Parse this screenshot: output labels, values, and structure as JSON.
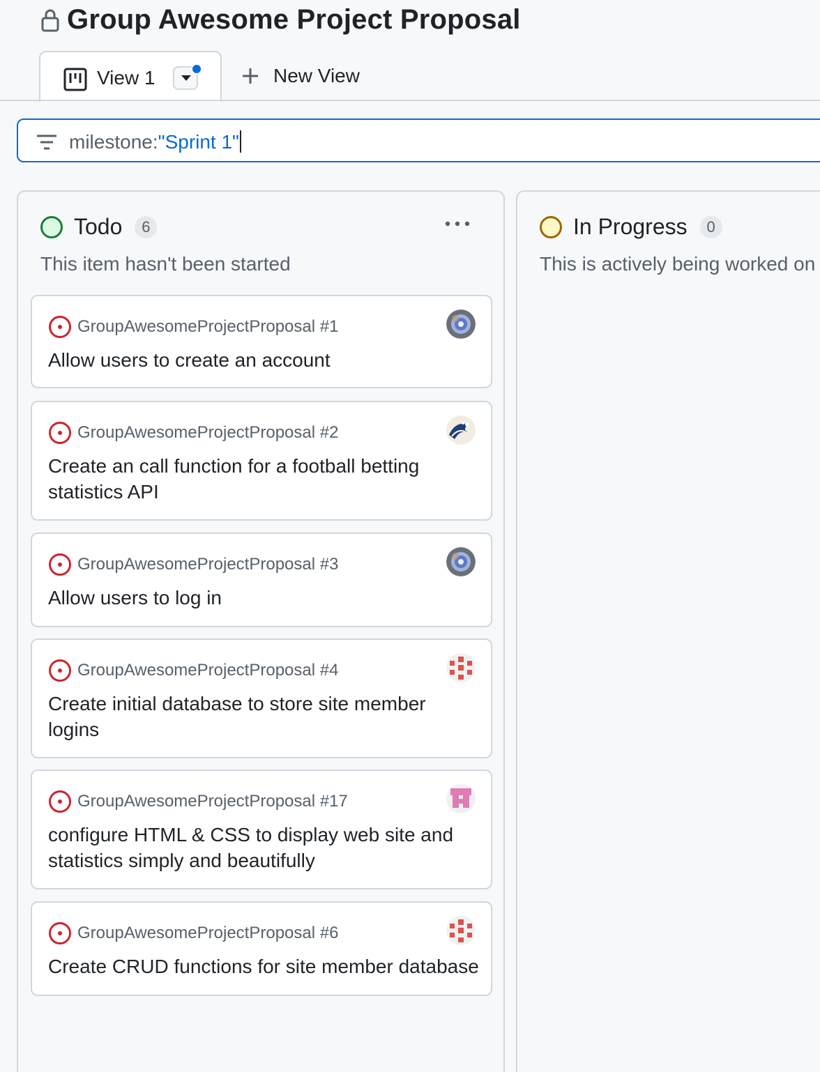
{
  "project": {
    "title": "Group Awesome Project Proposal"
  },
  "tabs": {
    "active_label": "View 1",
    "new_view_label": "New View"
  },
  "filter": {
    "key": "milestone:",
    "value": "\"Sprint 1\""
  },
  "columns": [
    {
      "name": "Todo",
      "count": "6",
      "description": "This item hasn't been started",
      "status_color": "#1a7f37"
    },
    {
      "name": "In Progress",
      "count": "0",
      "description": "This is actively being worked on",
      "status_color": "#9a6700"
    }
  ],
  "cards": [
    {
      "repo": "GroupAwesomeProjectProposal #1",
      "title": "Allow users to create an account",
      "avatar": "nebula-avatar"
    },
    {
      "repo": "GroupAwesomeProjectProposal #2",
      "title": "Create an call function for a football betting statistics API",
      "avatar": "wave-avatar"
    },
    {
      "repo": "GroupAwesomeProjectProposal #3",
      "title": "Allow users to log in",
      "avatar": "nebula-avatar"
    },
    {
      "repo": "GroupAwesomeProjectProposal #4",
      "title": "Create initial database to store site member logins",
      "avatar": "identicon-red"
    },
    {
      "repo": "GroupAwesomeProjectProposal #17",
      "title": "configure HTML & CSS to display web site and statistics simply and beautifully",
      "avatar": "identicon-pink"
    },
    {
      "repo": "GroupAwesomeProjectProposal #6",
      "title": "Create CRUD functions for site member database",
      "avatar": "identicon-red"
    }
  ],
  "colors": {
    "accent": "#0969da",
    "open_issue": "#cf222e",
    "border": "#d0d7de",
    "canvas": "#f6f8fa"
  }
}
